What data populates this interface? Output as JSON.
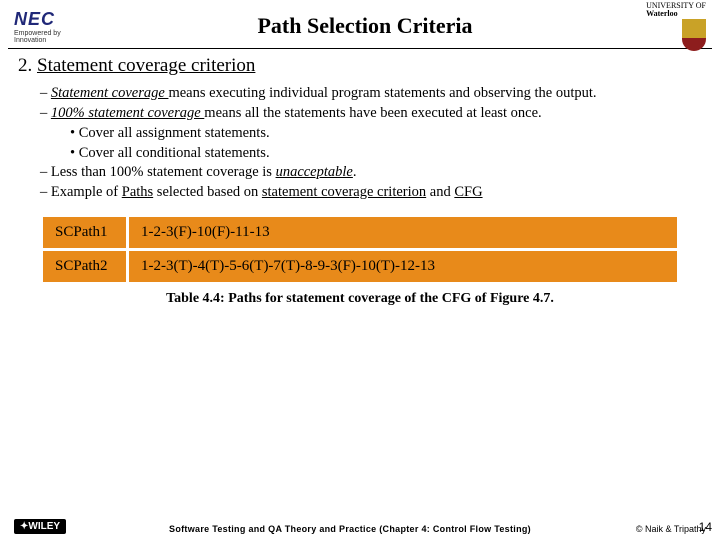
{
  "header": {
    "logo_left_main": "NEC",
    "logo_left_tag": "Empowered by Innovation",
    "title": "Path Selection Criteria",
    "logo_right_line1": "UNIVERSITY OF",
    "logo_right_line2": "Waterloo"
  },
  "section": {
    "number": "2.",
    "heading": "Statement coverage criterion"
  },
  "bullets": {
    "b1_pre": "Statement coverage ",
    "b1_post": "means executing individual program statements and observing the output.",
    "b2_pre": "100% statement coverage ",
    "b2_post": "means all the statements have been executed at least once.",
    "b2a": "Cover all assignment statements.",
    "b2b": "Cover all conditional statements.",
    "b3_pre": "Less than 100% statement coverage is ",
    "b3_em": "unacceptable",
    "b3_post": ".",
    "b4_pre": "Example of ",
    "b4_u1": "Paths",
    "b4_mid": " selected based on ",
    "b4_u2": "statement coverage criterion",
    "b4_and": " and ",
    "b4_u3": "CFG"
  },
  "table": {
    "rows": [
      {
        "label": "SCPath1",
        "value": "1-2-3(F)-10(F)-11-13"
      },
      {
        "label": "SCPath2",
        "value": "1-2-3(T)-4(T)-5-6(T)-7(T)-8-9-3(F)-10(T)-12-13"
      }
    ],
    "caption": "Table 4.4: Paths for statement coverage of the CFG of Figure 4.7."
  },
  "footer": {
    "wiley": "WILEY",
    "center": "Software Testing and QA Theory and Practice (Chapter 4: Control Flow Testing)",
    "right": "© Naik & Tripathy",
    "page": "14"
  }
}
